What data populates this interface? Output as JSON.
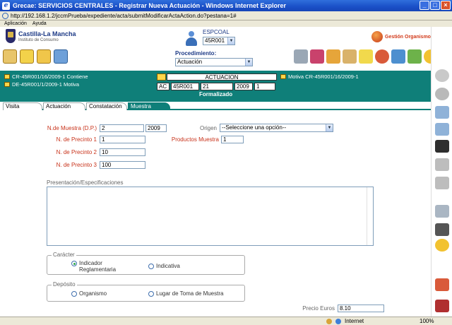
{
  "window": {
    "title": "Grecae: SERVICIOS CENTRALES - Registrar Nueva Actuación - Windows Internet Explorer",
    "address": "http://192.168.1.2/jccmPrueba/expediente/acta/submitModificarActaAction.do?pestana=1#"
  },
  "menu": [
    "Aplicación",
    "Ayuda"
  ],
  "header": {
    "logo_title": "Castilla-La Mancha",
    "logo_sub": "Instituto de Consumo",
    "espcoal_label": "ESPCOAL",
    "espcoal_value": "45R001",
    "gestion": "Gestión Organismo",
    "proc_label": "Procedimiento:",
    "proc_value": "Actuación"
  },
  "band": {
    "left1": "CR-45R001/16/2009-1 Contiene",
    "left2": "DE-45R001/1/2009-1   Motiva",
    "right1": "Motiva CR-45R001/16/2009-1",
    "act_title": "ACTUACION",
    "act_cells": [
      "AC",
      "45R001",
      "21",
      "2009",
      "1"
    ],
    "status": "Formalizado"
  },
  "tabs": [
    "Visita",
    "Actuación",
    "Constatación",
    "Muestra"
  ],
  "form": {
    "n_muestra_label": "N.de Muestra (D.P.)",
    "n_muestra_value": "2",
    "n_muestra_year": "2009",
    "origen_label": "Origen",
    "origen_value": "--Seleccione una opción--",
    "precinto1_label": "N. de Precinto 1",
    "precinto1_value": "1",
    "productos_label": "Productos Muestra",
    "productos_value": "1",
    "precinto2_label": "N. de Precinto 2",
    "precinto2_value": "10",
    "precinto3_label": "N. de Precinto 3",
    "precinto3_value": "100",
    "presentacion_label": "Presentación/Especificaciones",
    "caracter_legend": "Carácter",
    "caracter_opt1": "Indicador Reglamentaria",
    "caracter_opt2": "Indicativa",
    "deposito_legend": "Depósito",
    "deposito_opt1": "Organismo",
    "deposito_opt2": "Lugar de Toma de Muestra",
    "precio_label": "Precio Euros",
    "precio_value": "8.10"
  },
  "status": {
    "zone": "Internet",
    "zoom": "100%"
  },
  "colors": {
    "band": "#0f7f79",
    "label_red": "#c8321a",
    "titlebar": "#1a4fc7"
  }
}
